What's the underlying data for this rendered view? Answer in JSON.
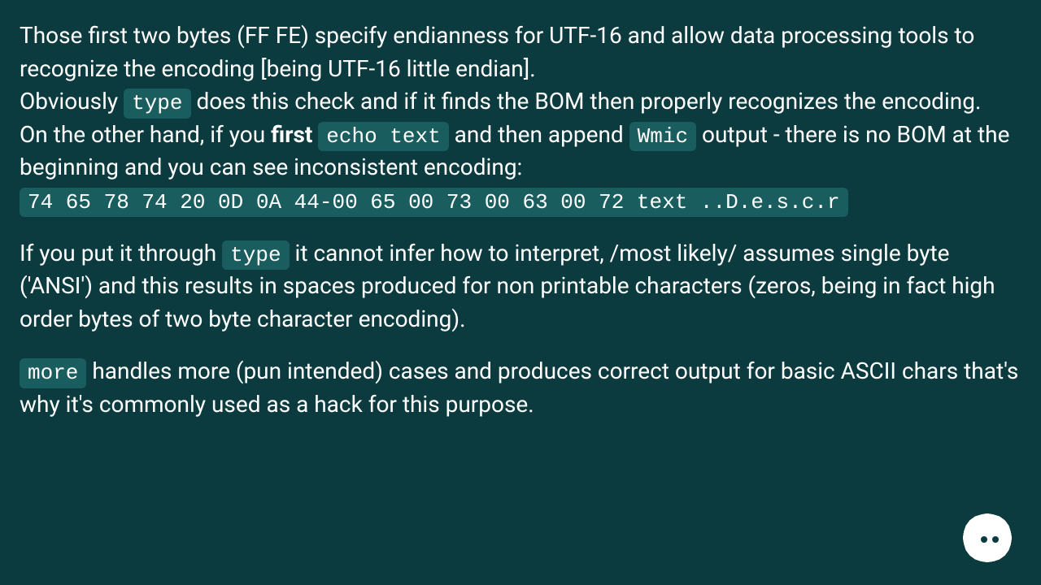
{
  "para1": {
    "line1": "Those first two bytes (FF FE) specify endianness for UTF-16 and allow data processing tools to recognize the encoding [being UTF-16 little endian].",
    "line2a": "Obviously ",
    "code1": "type",
    "line2b": " does this check and if it finds the BOM then properly recognizes the encoding.",
    "line3a": "On the other hand, if you ",
    "bold1": "first",
    "space1": " ",
    "code2": "echo text",
    "line3b": " and then append ",
    "code3": "Wmic",
    "line3c": " output - there is no BOM at the beginning and you can see inconsistent encoding:",
    "hex": "74 65 78 74 20 0D 0A 44-00 65 00 73 00 63 00 72 text ..D.e.s.c.r"
  },
  "para2": {
    "a": "If you put it through ",
    "code1": "type",
    "b": " it cannot infer how to interpret, /most likely/ assumes single byte ('ANSI') and this results in spaces produced for non printable characters (zeros, being in fact high order bytes of two byte character encoding)."
  },
  "para3": {
    "code1": "more",
    "a": " handles more (pun intended) cases and produces correct output for basic ASCII chars that's why it's commonly used as a hack for this purpose."
  }
}
